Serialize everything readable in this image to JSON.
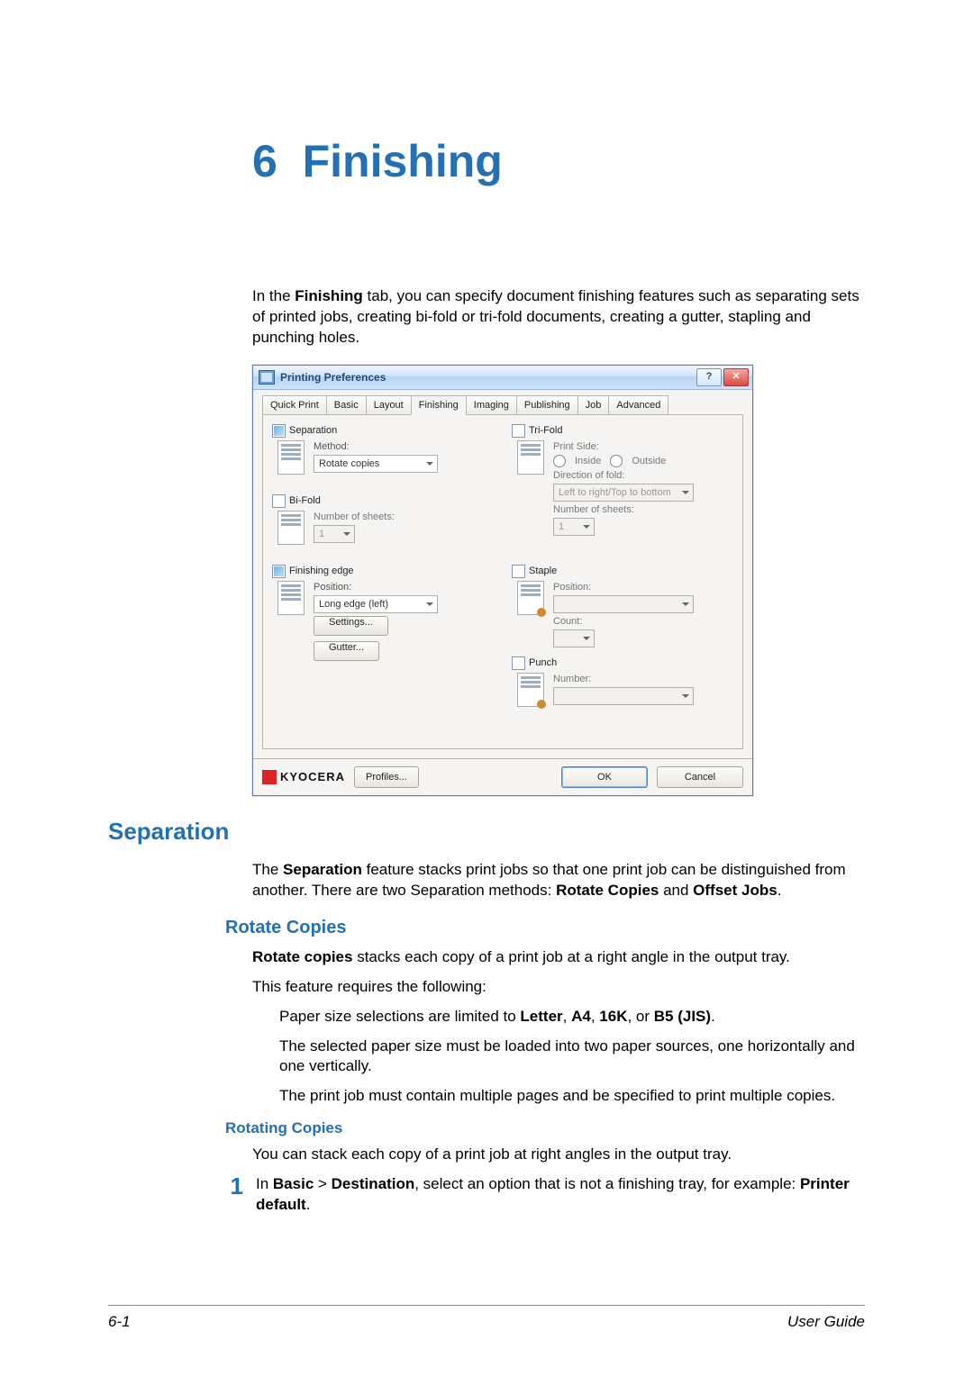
{
  "chapter": {
    "number": "6",
    "title": "Finishing"
  },
  "intro": {
    "p1a": "In the ",
    "p1b": "Finishing",
    "p1c": " tab, you can specify document finishing features such as separating sets of printed jobs, creating bi-fold or tri-fold documents, creating a gutter, stapling and punching holes."
  },
  "dialog": {
    "title": "Printing Preferences",
    "tabs": [
      "Quick Print",
      "Basic",
      "Layout",
      "Finishing",
      "Imaging",
      "Publishing",
      "Job",
      "Advanced"
    ],
    "active_tab_index": 3,
    "left": {
      "separation": {
        "label": "Separation",
        "checked": true,
        "method_label": "Method:",
        "method_value": "Rotate copies"
      },
      "bifold": {
        "label": "Bi-Fold",
        "checked": false,
        "sheets_label": "Number of sheets:",
        "sheets_value": "1"
      },
      "finishing_edge": {
        "label": "Finishing edge",
        "checked": true,
        "position_label": "Position:",
        "position_value": "Long edge (left)",
        "settings_btn": "Settings...",
        "gutter_btn": "Gutter..."
      }
    },
    "right": {
      "trifold": {
        "label": "Tri-Fold",
        "checked": false,
        "print_side_label": "Print Side:",
        "inside_label": "Inside",
        "outside_label": "Outside",
        "direction_label": "Direction of fold:",
        "direction_value": "Left to right/Top to bottom",
        "sheets_label": "Number of sheets:",
        "sheets_value": "1"
      },
      "staple": {
        "label": "Staple",
        "checked": false,
        "position_label": "Position:",
        "count_label": "Count:"
      },
      "punch": {
        "label": "Punch",
        "checked": false,
        "number_label": "Number:"
      }
    },
    "footer": {
      "brand": "KYOCERA",
      "profiles_btn": "Profiles...",
      "ok_btn": "OK",
      "cancel_btn": "Cancel"
    }
  },
  "sections": {
    "separation": {
      "heading": "Separation",
      "p1a": "The ",
      "p1b": "Separation",
      "p1c": " feature stacks print jobs so that one print job can be distinguished from another. There are two Separation methods: ",
      "p1d": "Rotate Copies",
      "p1e": " and ",
      "p1f": "Offset Jobs",
      "p1g": "."
    },
    "rotate_copies": {
      "heading": "Rotate Copies",
      "p1a": "Rotate copies",
      "p1b": " stacks each copy of a print job at a right angle in the output tray.",
      "p2": "This feature requires the following:",
      "b1a": "Paper size selections are limited to ",
      "b1_letter": "Letter",
      "b1_sep1": ", ",
      "b1_a4": "A4",
      "b1_sep2": ", ",
      "b1_16k": "16K",
      "b1_sep3": ", or ",
      "b1_b5": "B5 (JIS)",
      "b1_end": ".",
      "b2": "The selected paper size must be loaded into two paper sources, one horizontally and one vertically.",
      "b3": "The print job must contain multiple pages and be specified to print multiple copies."
    },
    "rotating_copies": {
      "heading": "Rotating Copies",
      "p1": "You can stack each copy of a print job at right angles in the output tray.",
      "step1_num": "1",
      "step1a": "In ",
      "step1b": "Basic",
      "step1c": " > ",
      "step1d": "Destination",
      "step1e": ", select an option that is not a finishing tray, for example: ",
      "step1f": "Printer default",
      "step1g": "."
    }
  },
  "page_footer": {
    "left": "6-1",
    "right": "User Guide"
  }
}
